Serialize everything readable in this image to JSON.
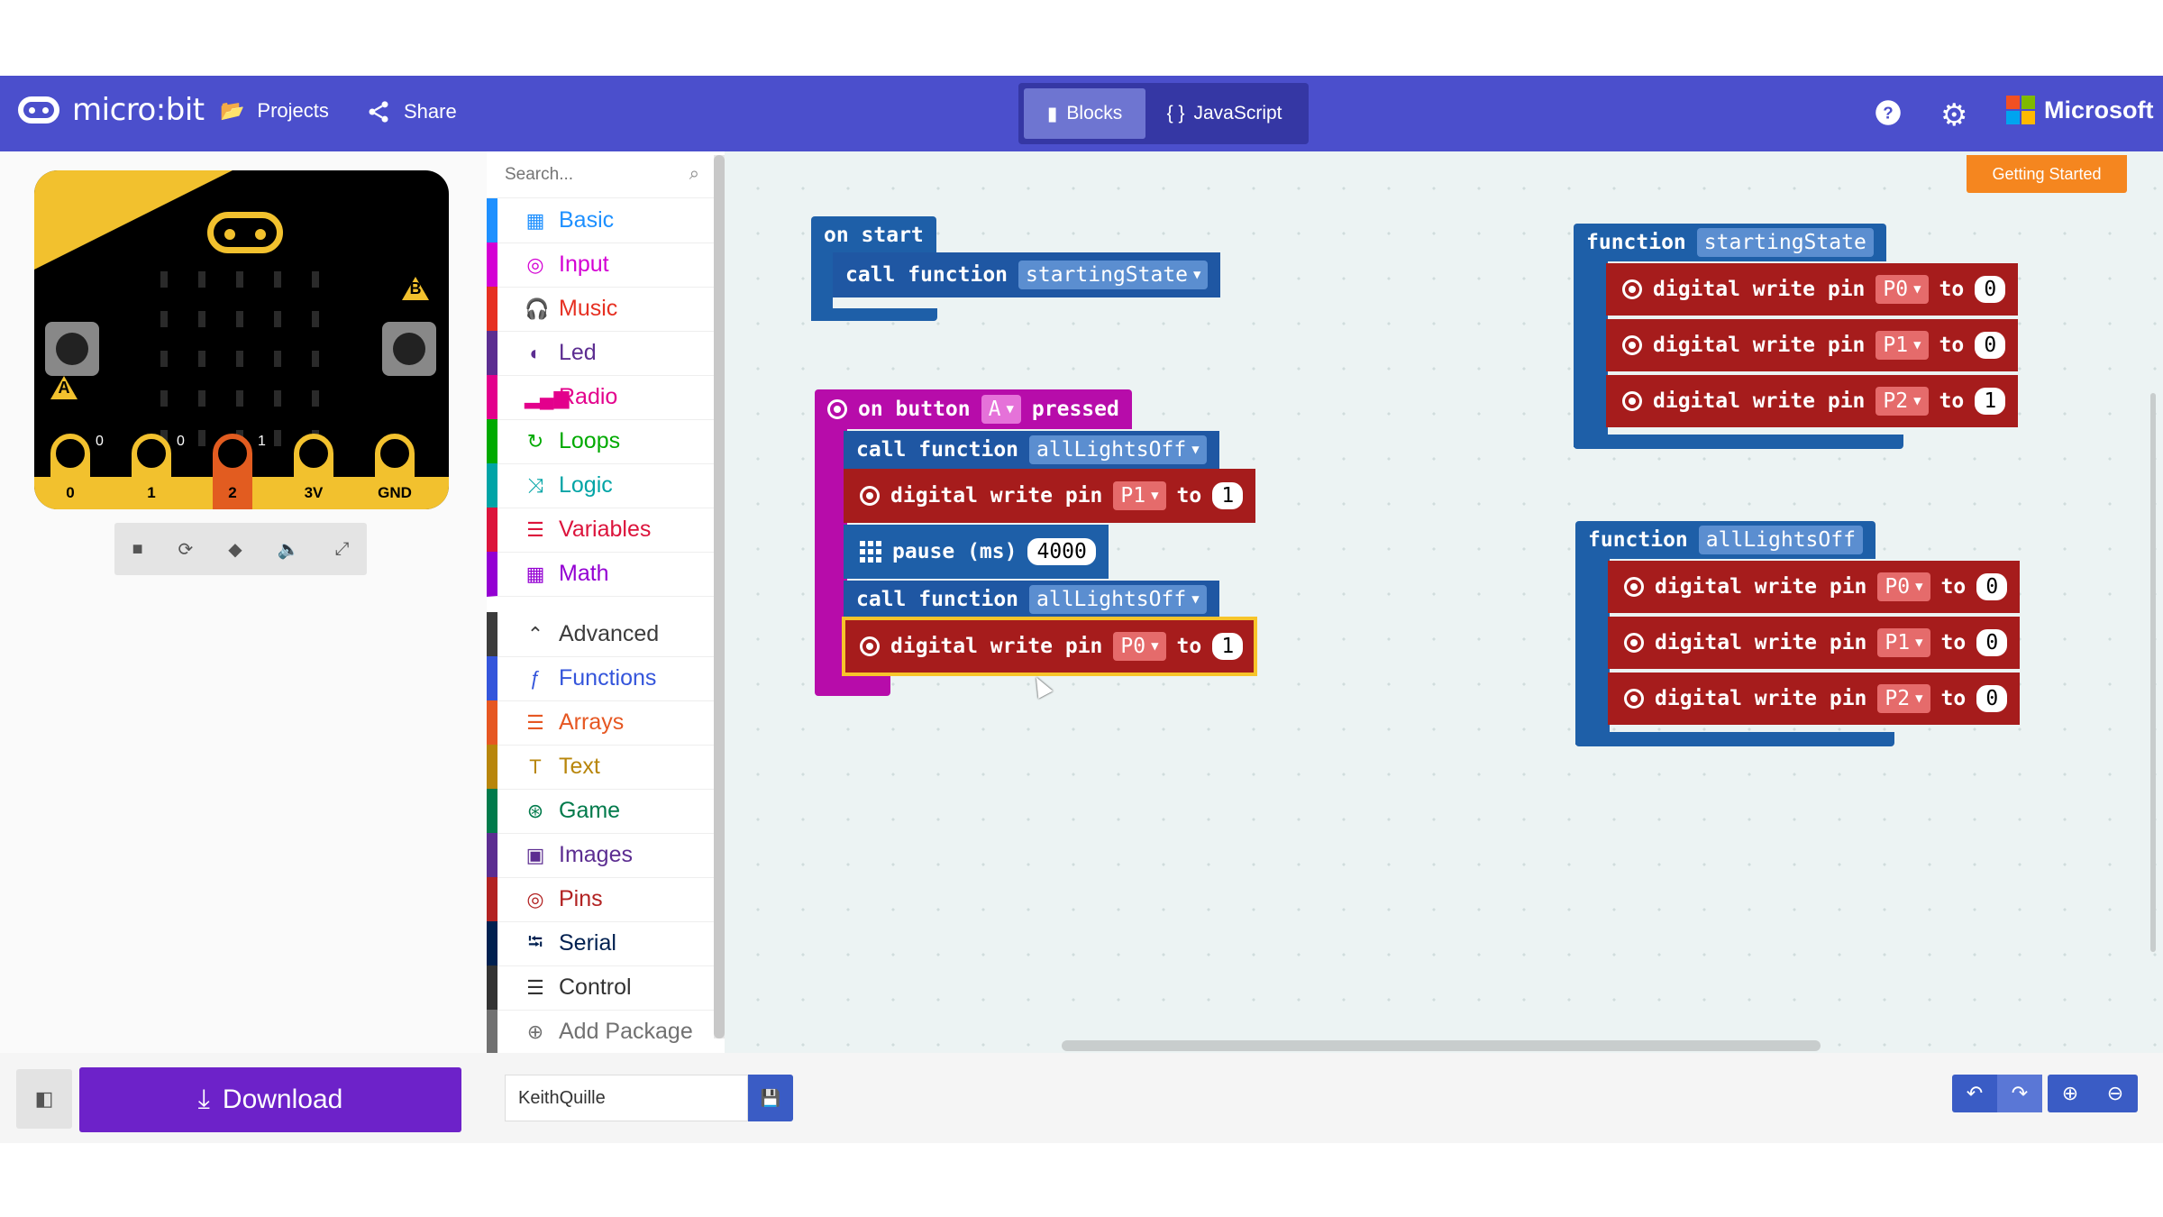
{
  "header": {
    "logo": "micro:bit",
    "projects": "Projects",
    "share": "Share",
    "modes": {
      "blocks": "Blocks",
      "javascript": "JavaScript"
    },
    "brand": "Microsoft",
    "brand_colors": [
      "#f25022",
      "#7fba00",
      "#00a4ef",
      "#ffb900"
    ]
  },
  "simulator": {
    "pins": [
      {
        "label": "0",
        "value": "0"
      },
      {
        "label": "1",
        "value": "0"
      },
      {
        "label": "2",
        "value": "1"
      },
      {
        "label": "3V",
        "value": ""
      },
      {
        "label": "GND",
        "value": ""
      }
    ],
    "button_a": "A",
    "button_b": "B"
  },
  "toolbox": {
    "search_placeholder": "Search...",
    "categories": [
      {
        "label": "Basic",
        "icon": "grid-icon",
        "color": "#1e90ff"
      },
      {
        "label": "Input",
        "icon": "target-icon",
        "color": "#d400d4"
      },
      {
        "label": "Music",
        "icon": "headphones-icon",
        "color": "#e63022"
      },
      {
        "label": "Led",
        "icon": "toggle-icon",
        "color": "#5c2d91"
      },
      {
        "label": "Radio",
        "icon": "signal-icon",
        "color": "#e3008c"
      },
      {
        "label": "Loops",
        "icon": "refresh-icon",
        "color": "#00aa00"
      },
      {
        "label": "Logic",
        "icon": "shuffle-icon",
        "color": "#00a4a6"
      },
      {
        "label": "Variables",
        "icon": "list-icon",
        "color": "#dc143c"
      },
      {
        "label": "Math",
        "icon": "calculator-icon",
        "color": "#9400d3"
      },
      {
        "label": "Advanced",
        "icon": "chevron-up-icon",
        "color": "#3c3c3c"
      },
      {
        "label": "Functions",
        "icon": "function-icon",
        "color": "#3455db"
      },
      {
        "label": "Arrays",
        "icon": "list-icon",
        "color": "#e65722"
      },
      {
        "label": "Text",
        "icon": "text-icon",
        "color": "#b8860b"
      },
      {
        "label": "Game",
        "icon": "gamepad-icon",
        "color": "#007a4b"
      },
      {
        "label": "Images",
        "icon": "image-icon",
        "color": "#5c2d91"
      },
      {
        "label": "Pins",
        "icon": "target-icon",
        "color": "#b22222"
      },
      {
        "label": "Serial",
        "icon": "usb-icon",
        "color": "#002050"
      },
      {
        "label": "Control",
        "icon": "control-icon",
        "color": "#333333"
      },
      {
        "label": "Add Package",
        "icon": "plus-icon",
        "color": "#717171"
      }
    ]
  },
  "workspace": {
    "getting_started": "Getting Started",
    "on_start": {
      "label": "on start",
      "call": "call function",
      "fn": "startingState"
    },
    "on_button": {
      "label_pre": "on button",
      "button": "A",
      "label_post": "pressed",
      "call1": {
        "label": "call function",
        "fn": "allLightsOff"
      },
      "write1": {
        "label": "digital write pin",
        "pin": "P1",
        "to": "to",
        "value": "1"
      },
      "pause": {
        "label": "pause (ms)",
        "value": "4000"
      },
      "call2": {
        "label": "call function",
        "fn": "allLightsOff"
      },
      "write2": {
        "label": "digital write pin",
        "pin": "P0",
        "to": "to",
        "value": "1"
      }
    },
    "fn_starting": {
      "label": "function",
      "name": "startingState",
      "writes": [
        {
          "label": "digital write pin",
          "pin": "P0",
          "to": "to",
          "value": "0"
        },
        {
          "label": "digital write pin",
          "pin": "P1",
          "to": "to",
          "value": "0"
        },
        {
          "label": "digital write pin",
          "pin": "P2",
          "to": "to",
          "value": "1"
        }
      ]
    },
    "fn_alloff": {
      "label": "function",
      "name": "allLightsOff",
      "writes": [
        {
          "label": "digital write pin",
          "pin": "P0",
          "to": "to",
          "value": "0"
        },
        {
          "label": "digital write pin",
          "pin": "P1",
          "to": "to",
          "value": "0"
        },
        {
          "label": "digital write pin",
          "pin": "P2",
          "to": "to",
          "value": "0"
        }
      ]
    }
  },
  "bottom": {
    "download": "Download",
    "project_name": "KeithQuille"
  }
}
